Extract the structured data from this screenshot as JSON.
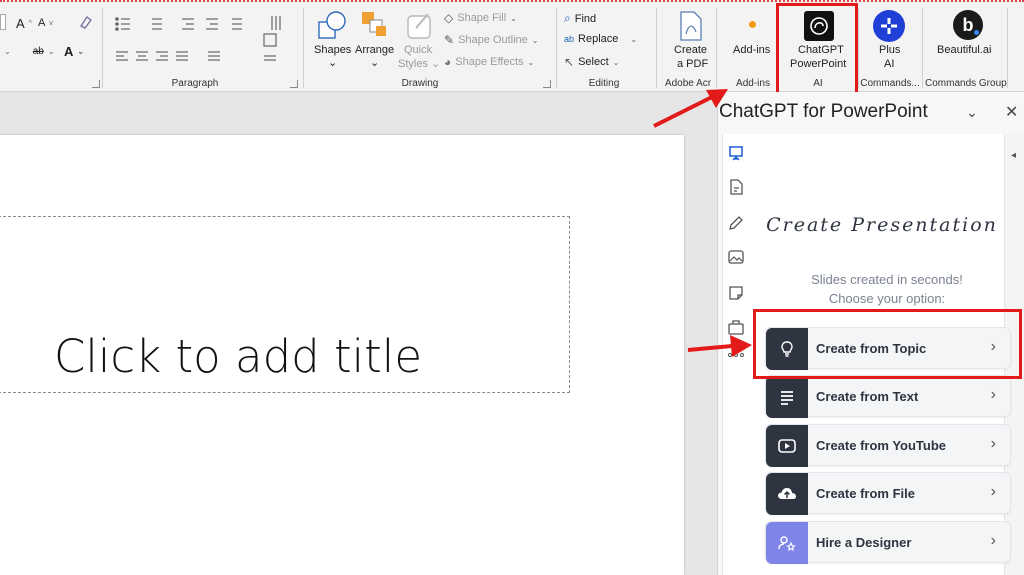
{
  "ribbon": {
    "groups": {
      "paragraph": "Paragraph",
      "drawing": "Drawing",
      "editing": "Editing",
      "adobe": "Adobe Acr",
      "addins": "Add-ins",
      "ai": "AI",
      "commands": "Commands...",
      "commands_group": "Commands Group"
    },
    "drawing": {
      "shapes": "Shapes",
      "arrange": "Arrange",
      "quick_styles_1": "Quick",
      "quick_styles_2": "Styles",
      "shape_fill": "Shape Fill",
      "shape_outline": "Shape Outline",
      "shape_effects": "Shape Effects"
    },
    "editing": {
      "find": "Find",
      "replace": "Replace",
      "select": "Select"
    },
    "adobe": {
      "line1": "Create",
      "line2": "a PDF"
    },
    "addins_btn": "Add-ins",
    "chatgpt": {
      "line1": "ChatGPT",
      "line2": "PowerPoint"
    },
    "plus": {
      "line1": "Plus",
      "line2": "AI"
    },
    "beautiful": "Beautiful.ai",
    "font_size_up": "A",
    "font_size_down": "A",
    "font_color": "A",
    "spacing": "ab"
  },
  "slide": {
    "title_placeholder": "Click to add title"
  },
  "pane": {
    "title": "ChatGPT for PowerPoint",
    "heading": "Create Presentation",
    "subtitle1": "Slides created in seconds!",
    "subtitle2": "Choose your option:",
    "options": [
      {
        "prefix": "Create from ",
        "bold": "Topic",
        "icon": "lightbulb-icon"
      },
      {
        "prefix": "Create from ",
        "bold": "Text",
        "icon": "text-lines-icon"
      },
      {
        "prefix": "Create from ",
        "bold": "YouTube",
        "icon": "youtube-icon"
      },
      {
        "prefix": "Create from ",
        "bold": "File",
        "icon": "cloud-upload-icon"
      },
      {
        "prefix": "Hire a ",
        "bold": "Designer",
        "icon": "designer-icon"
      }
    ]
  },
  "colors": {
    "highlight": "#e21a1a",
    "dark_tile": "#2e3440",
    "purple_tile": "#7f84e8",
    "plus_ai": "#1f3fd6"
  }
}
